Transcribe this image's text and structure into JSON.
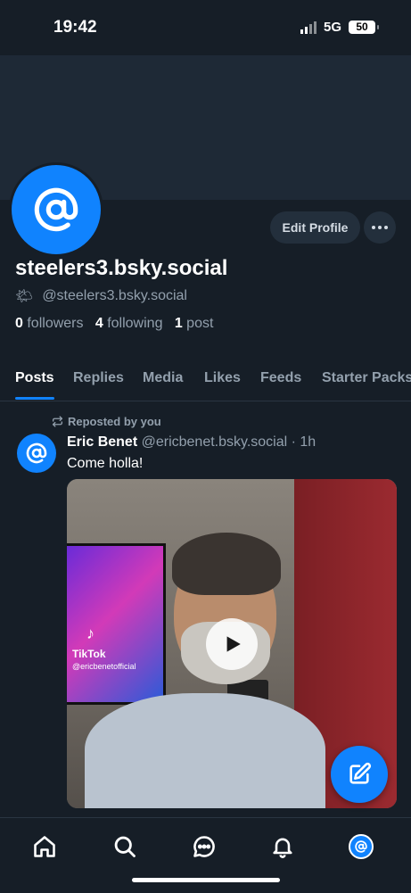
{
  "status_bar": {
    "time": "19:42",
    "network": "5G",
    "battery": "50"
  },
  "profile": {
    "edit_label": "Edit Profile",
    "display_name": "steelers3.bsky.social",
    "handle": "@steelers3.bsky.social",
    "emoji": "🌤",
    "followers_count": "0",
    "followers_label": "followers",
    "following_count": "4",
    "following_label": "following",
    "posts_count": "1",
    "posts_label": "post"
  },
  "tabs": [
    {
      "label": "Posts",
      "active": true
    },
    {
      "label": "Replies"
    },
    {
      "label": "Media"
    },
    {
      "label": "Likes"
    },
    {
      "label": "Feeds"
    },
    {
      "label": "Starter Packs"
    }
  ],
  "post": {
    "repost_label": "Reposted by you",
    "author_name": "Eric Benet",
    "author_handle": "@ericbenet.bsky.social",
    "separator": "·",
    "time": "1h",
    "text": "Come holla!",
    "video": {
      "overlay_brand": "TikTok",
      "overlay_handle": "@ericbenetofficial"
    }
  },
  "colors": {
    "accent": "#1083fe",
    "background": "#161e27",
    "banner": "#1e2936",
    "muted_text": "#93a0ad"
  },
  "icons": {
    "nav": [
      "home-icon",
      "search-icon",
      "chat-icon",
      "bell-icon",
      "profile-avatar"
    ],
    "fab": "compose-icon",
    "repost": "repost-icon",
    "play": "play-icon",
    "more": "ellipsis-icon"
  }
}
